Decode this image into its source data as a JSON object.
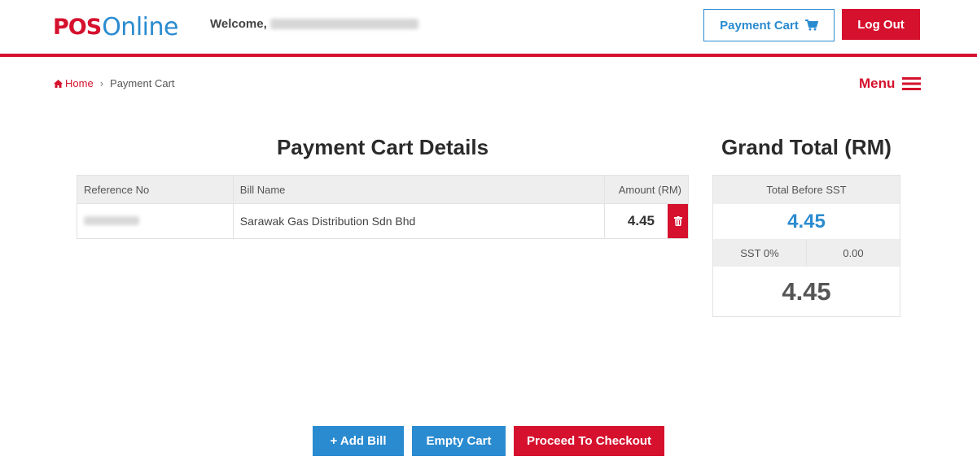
{
  "header": {
    "logo": {
      "pos": "POS",
      "online": "Online"
    },
    "welcome_label": "Welcome,",
    "cart_button": "Payment Cart",
    "logout_button": "Log Out"
  },
  "breadcrumb": {
    "home": "Home",
    "current": "Payment Cart"
  },
  "menu_label": "Menu",
  "cart": {
    "title": "Payment Cart Details",
    "columns": {
      "ref": "Reference No",
      "bill": "Bill Name",
      "amount": "Amount (RM)"
    },
    "rows": [
      {
        "bill_name": "Sarawak Gas Distribution Sdn Bhd",
        "amount": "4.45"
      }
    ]
  },
  "grand_total": {
    "title": "Grand Total (RM)",
    "before_label": "Total Before SST",
    "before_value": "4.45",
    "sst_label": "SST 0%",
    "sst_value": "0.00",
    "final_value": "4.45"
  },
  "actions": {
    "add_bill": "+ Add Bill",
    "empty_cart": "Empty Cart",
    "checkout": "Proceed To Checkout"
  },
  "colors": {
    "brand_red": "#d5112e",
    "brand_blue": "#2a8bd0"
  }
}
